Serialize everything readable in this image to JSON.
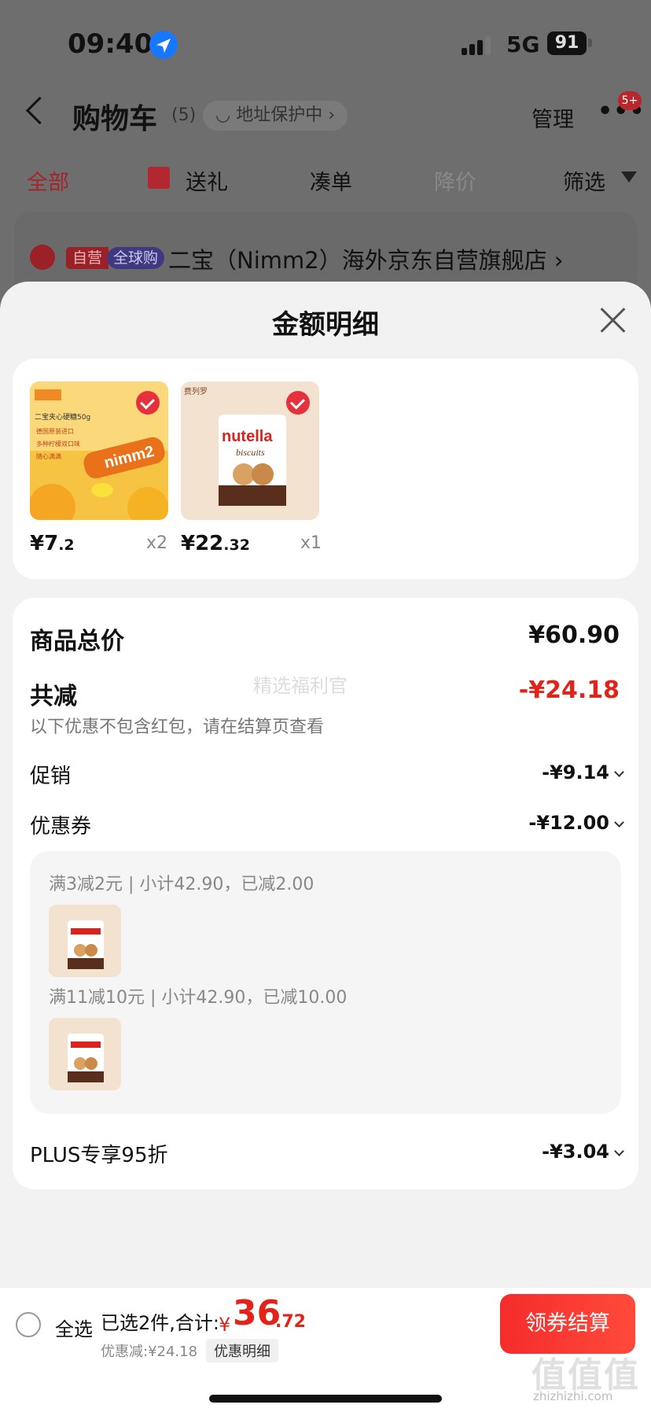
{
  "status": {
    "time": "09:40",
    "network": "5G",
    "battery": "91"
  },
  "nav": {
    "title": "购物车",
    "count": "(5)",
    "address": "地址保护中",
    "manage": "管理",
    "badge": "5+"
  },
  "tabs": [
    "全部",
    "送礼",
    "凑单",
    "降价",
    "筛选"
  ],
  "store": {
    "tag1": "自营",
    "tag2": "全球购",
    "name": "二宝（Nimm2）海外京东自营旗舰店"
  },
  "sheet": {
    "title": "金额明细",
    "products": [
      {
        "price_main": "¥7",
        "price_dec": ".2",
        "qty": "x2"
      },
      {
        "price_main": "¥22",
        "price_dec": ".32",
        "qty": "x1"
      }
    ],
    "summary": {
      "total_label": "商品总价",
      "total_value": "¥60.90",
      "reduce_label": "共减",
      "reduce_value": "-¥24.18",
      "reduce_note": "以下优惠不包含红包，请在结算页查看",
      "promo_label": "促销",
      "promo_value": "-¥9.14",
      "coupon_label": "优惠券",
      "coupon_value": "-¥12.00",
      "coupon_rule1": "满3减2元 | 小计42.90，已减2.00",
      "coupon_rule2": "满11减10元 | 小计42.90，已减10.00",
      "plus_label": "PLUS专享95折",
      "plus_value": "-¥3.04"
    }
  },
  "product_image_text": {
    "nimm_title": "二宝夹心硬糖50g",
    "nimm_line2": "德国原装进口",
    "nimm_line3": "多种柠檬双口味",
    "nimm_line4": "随心满满",
    "nutella_brand": "费列罗",
    "nutella_name": "nutella",
    "nutella_sub": "biscuits"
  },
  "bottom": {
    "select_all": "全选",
    "selected": "已选2件,合计:",
    "currency": "¥",
    "total_main": "36",
    "total_dec": ".72",
    "discount": "优惠减:¥24.18",
    "detail": "优惠明细",
    "checkout": "领券结算"
  },
  "watermark": {
    "center": "精选福利官",
    "brand": "值值值",
    "site": "zhizhizhi.com"
  }
}
